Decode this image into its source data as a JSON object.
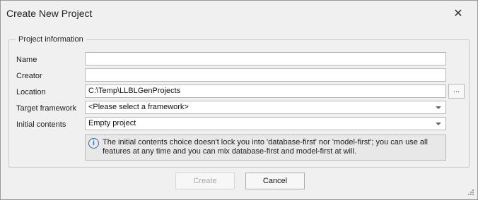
{
  "window": {
    "title": "Create New Project",
    "close_glyph": "✕"
  },
  "group": {
    "legend": "Project information"
  },
  "form": {
    "name_label": "Name",
    "name_value": "",
    "creator_label": "Creator",
    "creator_value": "",
    "location_label": "Location",
    "location_value": "C:\\Temp\\LLBLGenProjects",
    "browse_label": "...",
    "target_framework_label": "Target framework",
    "target_framework_value": "<Please select a framework>",
    "initial_contents_label": "Initial contents",
    "initial_contents_value": "Empty project"
  },
  "info": {
    "icon": "info-icon",
    "glyph": "i",
    "text": "The initial contents choice doesn't lock you into 'database-first' nor 'model-first'; you can use all features at any time and you can mix database-first and model-first at will."
  },
  "buttons": {
    "create": "Create",
    "cancel": "Cancel"
  }
}
